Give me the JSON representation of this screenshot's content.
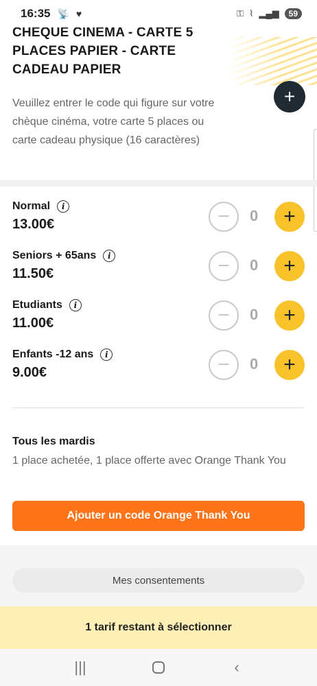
{
  "status": {
    "time": "16:35",
    "battery": "59",
    "left_icons": [
      "antenna-icon",
      "heart-signal-icon"
    ],
    "right_icons": [
      "key-icon",
      "wifi-icon",
      "signal-icon"
    ]
  },
  "card": {
    "title": "CHÈQUE CINÉMA - CARTE 5 PLACES PAPIER - CARTE CADEAU PAPIER",
    "add_label": "+",
    "instructions": "Veuillez entrer le code qui figure sur votre chèque cinéma, votre carte 5 places ou carte cadeau physique (16 caractères)"
  },
  "rates": [
    {
      "name": "Normal",
      "price": "13.00€",
      "qty": "0"
    },
    {
      "name": "Seniors + 65ans",
      "price": "11.50€",
      "qty": "0"
    },
    {
      "name": "Etudiants",
      "price": "11.00€",
      "qty": "0"
    },
    {
      "name": "Enfants -12 ans",
      "price": "9.00€",
      "qty": "0"
    }
  ],
  "promo": {
    "title": "Tous les mardis",
    "text": "1 place achetée, 1 place offerte avec Orange Thank You",
    "button": "Ajouter un code Orange Thank You"
  },
  "consent": {
    "label": "Mes consentements"
  },
  "bottom_banner": {
    "text": "1 tarif restant à sélectionner"
  },
  "colors": {
    "accent_yellow": "#f8c32a",
    "orange": "#ff7418",
    "dark_button": "#1f2a33",
    "banner_bg": "#fdefb5"
  }
}
